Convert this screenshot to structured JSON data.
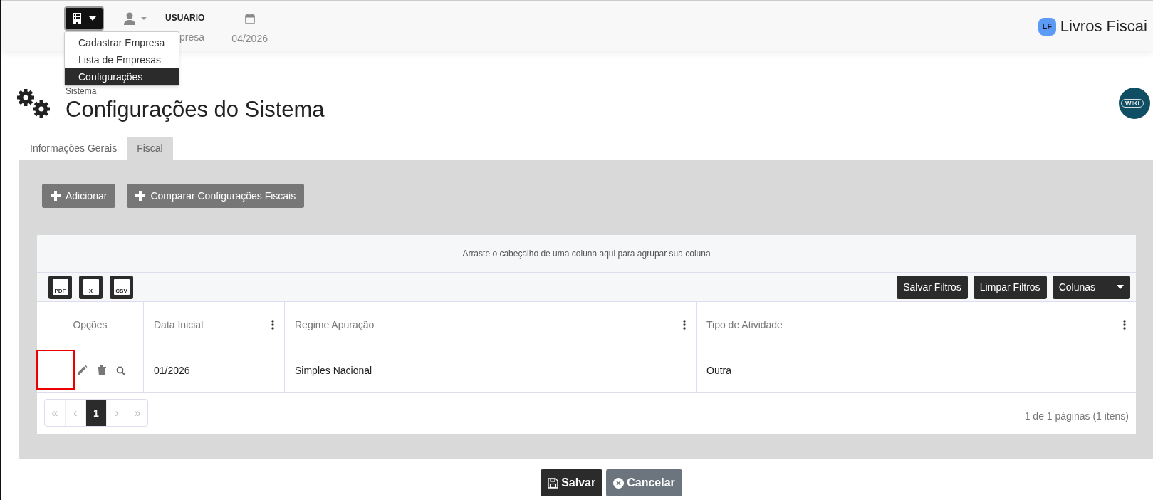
{
  "header": {
    "user_name": "USUARIO",
    "company": "presa",
    "period": "04/2026",
    "brand": "Livros Fiscai",
    "brand_badge": "LF"
  },
  "company_menu": {
    "expanded": true,
    "items": [
      {
        "label": "Cadastrar Empresa",
        "selected": false
      },
      {
        "label": "Lista de Empresas",
        "selected": false
      },
      {
        "label": "Configurações",
        "selected": true
      }
    ]
  },
  "breadcrumb": "Sistema",
  "title": "Configurações do Sistema",
  "wiki_badge": "WIKI",
  "tabs": [
    {
      "label": "Informações Gerais",
      "selected": false
    },
    {
      "label": "Fiscal",
      "selected": true
    }
  ],
  "actions": [
    "Adicionar",
    "Comparar Configurações Fiscais"
  ],
  "grid": {
    "group_hint": "Arraste o cabeçalho de uma coluna aqui para agrupar sua coluna",
    "export_buttons": [
      "PDF",
      "X",
      "CSV"
    ],
    "toolbar_buttons": [
      {
        "label": "Salvar Filtros",
        "kind": "plain"
      },
      {
        "label": "Limpar Filtros",
        "kind": "plain"
      },
      {
        "label": "Colunas",
        "kind": "dropdown"
      }
    ],
    "columns": [
      {
        "label": "Opções",
        "menu": false
      },
      {
        "label": "Data Inicial",
        "menu": true
      },
      {
        "label": "Regime Apuração",
        "menu": true
      },
      {
        "label": "Tipo de Atividade",
        "menu": true
      }
    ],
    "rows": [
      {
        "cells": [
          "",
          "01/2026",
          "Simples Nacional",
          "Outra"
        ],
        "highlighted": true
      }
    ],
    "pager": {
      "first": "«",
      "prev": "‹",
      "pages": [
        {
          "label": "1",
          "selected": true
        }
      ],
      "next": "›",
      "last": "»",
      "summary": "1 de 1 páginas (1 itens)"
    }
  },
  "footer_buttons": [
    {
      "label": "Salvar",
      "kind": "primary"
    },
    {
      "label": "Cancelar",
      "kind": "secondary"
    }
  ]
}
